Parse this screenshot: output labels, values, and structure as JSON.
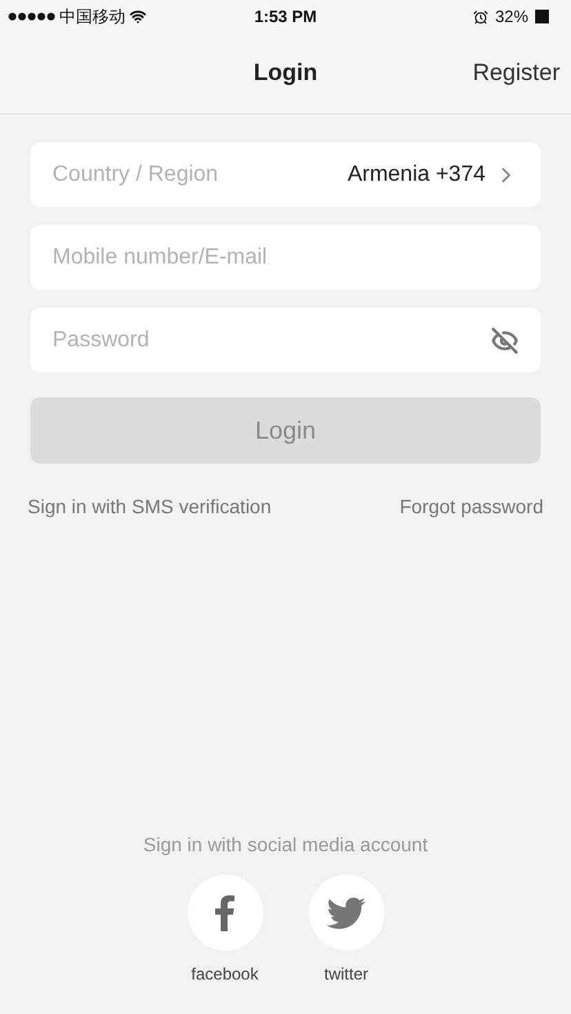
{
  "status_bar": {
    "carrier": "中国移动",
    "time": "1:53 PM",
    "battery": "32%"
  },
  "nav": {
    "title": "Login",
    "action": "Register"
  },
  "country": {
    "label": "Country / Region",
    "value": "Armenia +374"
  },
  "fields": [
    {
      "kind": "text",
      "placeholder": "Mobile number/E-mail"
    },
    {
      "kind": "password",
      "placeholder": "Password"
    }
  ],
  "login_button": {
    "label": "Login",
    "disabled": true
  },
  "links": [
    "Sign in with SMS verification",
    "Forgot password"
  ],
  "social": {
    "title": "Sign in with social media account",
    "accounts": [
      {
        "kind": "facebook",
        "label": "facebook"
      },
      {
        "kind": "twitter",
        "label": "twitter"
      }
    ]
  }
}
